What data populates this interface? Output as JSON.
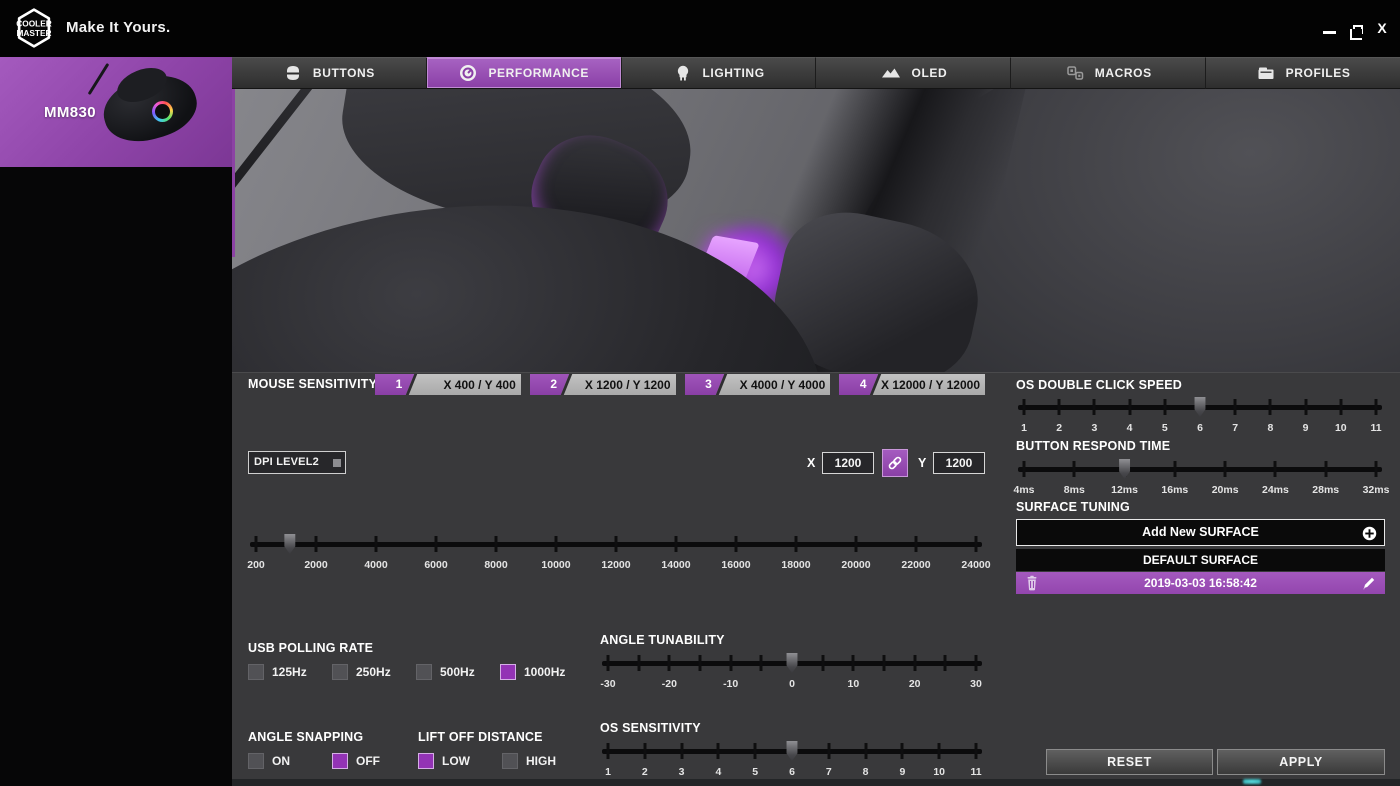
{
  "titlebar": {
    "logo_top": "COOLER",
    "logo_bottom": "MASTER",
    "tagline": "Make It Yours."
  },
  "sidebar": {
    "device_name": "MM830"
  },
  "tabs": [
    {
      "label": "BUTTONS"
    },
    {
      "label": "PERFORMANCE"
    },
    {
      "label": "LIGHTING"
    },
    {
      "label": "OLED"
    },
    {
      "label": "MACROS"
    },
    {
      "label": "PROFILES"
    }
  ],
  "colors": {
    "accent": "#9346ae",
    "accent_bright": "#a763c2",
    "panel": "#39393b",
    "glow": "#b44ee0",
    "checked": "#9333b5"
  },
  "sensitivity": {
    "label": "MOUSE SENSITIVITY",
    "levels": [
      {
        "num": "1",
        "value": "X 400 / Y 400"
      },
      {
        "num": "2",
        "value": "X 1200 / Y 1200"
      },
      {
        "num": "3",
        "value": "X 4000 / Y 4000"
      },
      {
        "num": "4",
        "value": "X 12000 / Y 12000"
      }
    ]
  },
  "dpi": {
    "dropdown_value": "DPI LEVEL2",
    "x_label": "X",
    "x_value": "1200",
    "y_label": "Y",
    "y_value": "1200",
    "slider": {
      "labels": [
        "200",
        "2000",
        "4000",
        "6000",
        "8000",
        "10000",
        "12000",
        "14000",
        "16000",
        "18000",
        "20000",
        "22000",
        "24000"
      ],
      "minor": 0,
      "handle": 0.047
    }
  },
  "usb_polling": {
    "label": "USB POLLING RATE",
    "options": [
      {
        "label": "125Hz",
        "checked": false
      },
      {
        "label": "250Hz",
        "checked": false
      },
      {
        "label": "500Hz",
        "checked": false
      },
      {
        "label": "1000Hz",
        "checked": true
      }
    ]
  },
  "angle_snapping": {
    "label": "ANGLE SNAPPING",
    "options": [
      {
        "label": "ON",
        "checked": false
      },
      {
        "label": "OFF",
        "checked": true
      }
    ]
  },
  "lift_off": {
    "label": "LIFT OFF DISTANCE",
    "options": [
      {
        "label": "LOW",
        "checked": true
      },
      {
        "label": "HIGH",
        "checked": false
      }
    ]
  },
  "angle_tunability": {
    "label": "ANGLE TUNABILITY",
    "slider": {
      "labels": [
        "-30",
        "-20",
        "-10",
        "0",
        "10",
        "20",
        "30"
      ],
      "minor": 1,
      "handle": 0.5
    }
  },
  "os_sensitivity": {
    "label": "OS SENSITIVITY",
    "slider": {
      "labels": [
        "1",
        "2",
        "3",
        "4",
        "5",
        "6",
        "7",
        "8",
        "9",
        "10",
        "11"
      ],
      "minor": 0,
      "handle": 0.5
    }
  },
  "os_double_click": {
    "label": "OS DOUBLE CLICK SPEED",
    "slider": {
      "labels": [
        "1",
        "2",
        "3",
        "4",
        "5",
        "6",
        "7",
        "8",
        "9",
        "10",
        "11"
      ],
      "minor": 0,
      "handle": 0.5
    }
  },
  "button_respond": {
    "label": "BUTTON RESPOND TIME",
    "slider": {
      "labels": [
        "4ms",
        "8ms",
        "12ms",
        "16ms",
        "20ms",
        "24ms",
        "28ms",
        "32ms"
      ],
      "minor": 0,
      "handle": 0.2857
    }
  },
  "surface": {
    "label": "SURFACE TUNING",
    "add_label": "Add New SURFACE",
    "default_item": "DEFAULT SURFACE",
    "custom_item": "2019-03-03 16:58:42"
  },
  "actions": {
    "reset": "RESET",
    "apply": "APPLY"
  }
}
